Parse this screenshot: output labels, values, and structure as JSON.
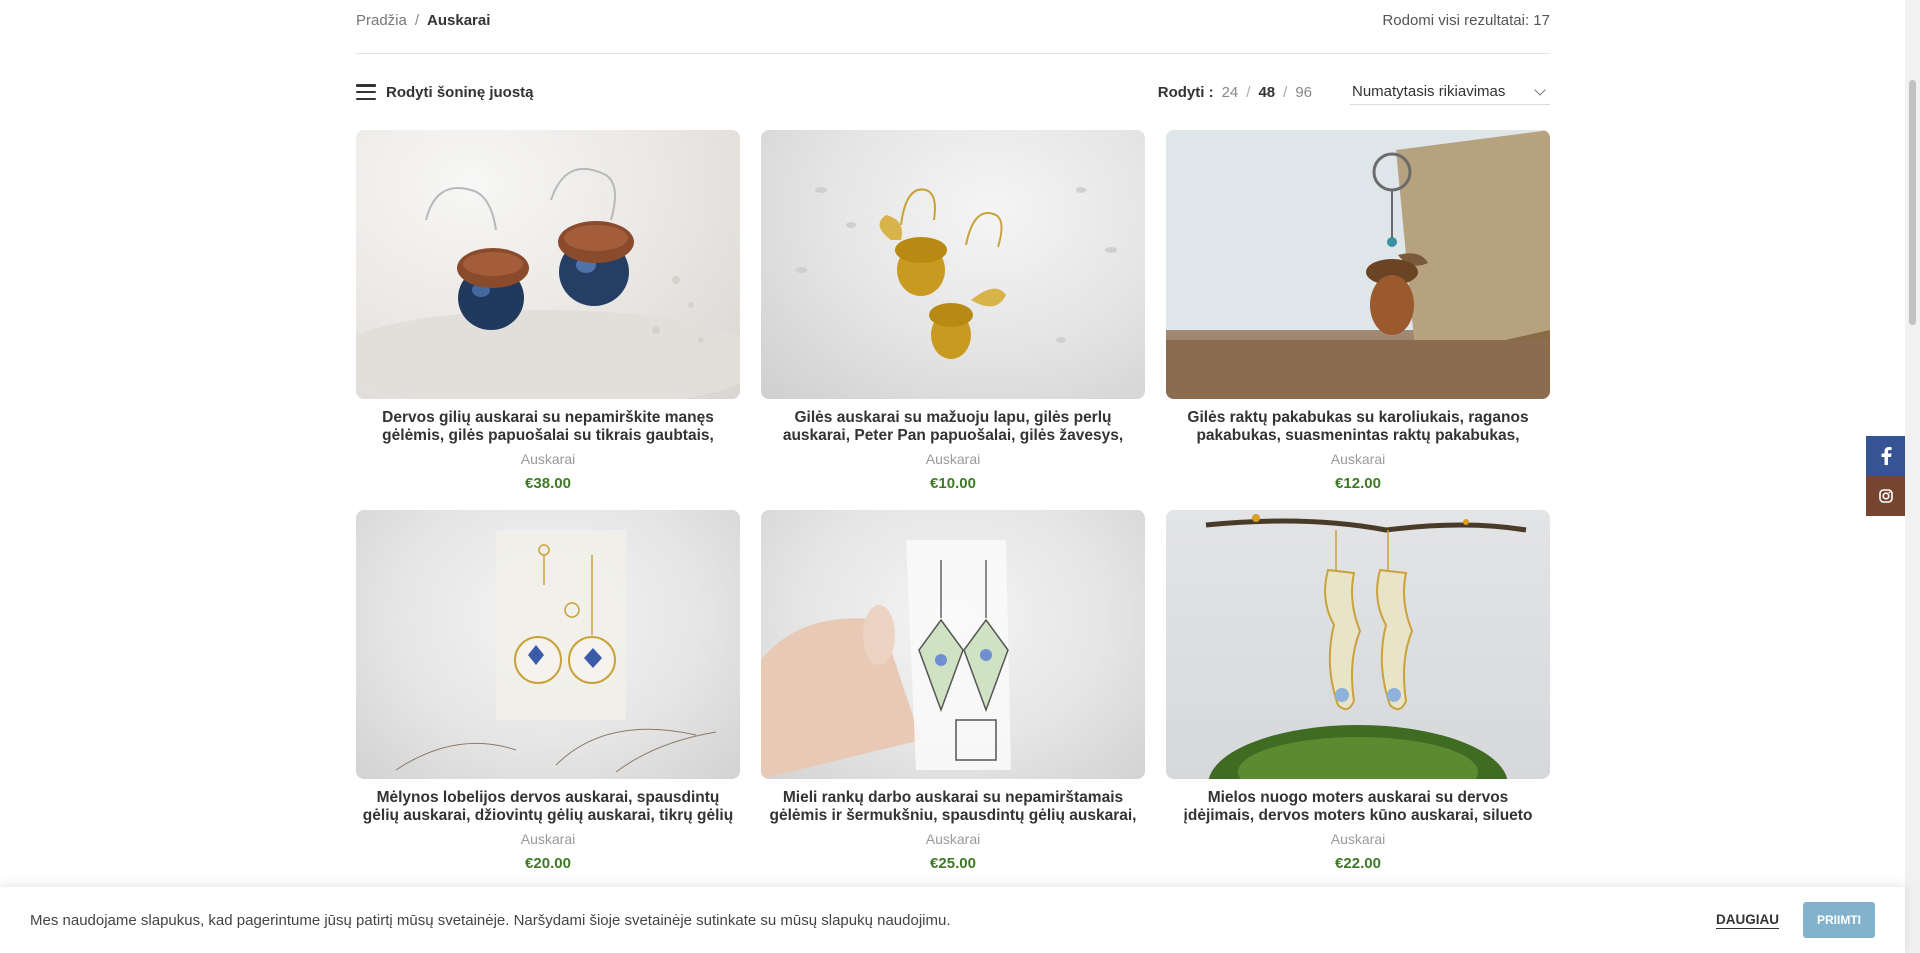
{
  "breadcrumb": {
    "home": "Pradžia",
    "separator": "/",
    "current": "Auskarai"
  },
  "results_text": "Rodomi visi rezultatai: 17",
  "toolbar": {
    "sidebar_label": "Rodyti šoninę juostą",
    "per_page_label": "Rodyti :",
    "per_page_options": [
      "24",
      "48",
      "96"
    ],
    "per_page_active": "48",
    "sort_value": "Numatytasis rikiavimas"
  },
  "products": [
    {
      "title": "Dervos gilių auskarai su nepamirškite manęs gėlėmis, gilės papuošalai su tikrais gaubtais, Peter",
      "category": "Auskarai",
      "price": "€38.00"
    },
    {
      "title": "Gilės auskarai su mažuoju lapu, gilės perlų auskarai, Peter Pan papuošalai, gilės žavesys, augaliniai",
      "category": "Auskarai",
      "price": "€10.00"
    },
    {
      "title": "Gilės raktų pakabukas su karoliukais, raganos pakabukas, suasmenintas raktų pakabukas, pirmųjų",
      "category": "Auskarai",
      "price": "€12.00"
    },
    {
      "title": "Mėlynos lobelijos dervos auskarai, spausdintų gėlių auskarai, džiovintų gėlių auskarai, tikrų gėlių",
      "category": "Auskarai",
      "price": "€20.00"
    },
    {
      "title": "Mieli rankų darbo auskarai su nepamirštamais gėlėmis ir šermukšniu, spausdintų gėlių auskarai,",
      "category": "Auskarai",
      "price": "€25.00"
    },
    {
      "title": "Mielos nuogo moters auskarai su dervos įdėjimais, dervos moters kūno auskarai, silueto auskarai.",
      "category": "Auskarai",
      "price": "€22.00"
    }
  ],
  "social": {
    "facebook_icon": "facebook-icon",
    "instagram_icon": "instagram-icon",
    "facebook_color": "#365493",
    "instagram_color": "#774430"
  },
  "cookie": {
    "message": "Mes naudojame slapukus, kad pagerintume jūsų patirtį mūsų svetainėje. Naršydami šioje svetainėje sutinkate su mūsų slapukų naudojimu.",
    "more_label": "DAUGIAU",
    "accept_label": "PRIIMTI"
  },
  "colors": {
    "price": "#3e7a26",
    "accept_button": "#83b3cc"
  }
}
